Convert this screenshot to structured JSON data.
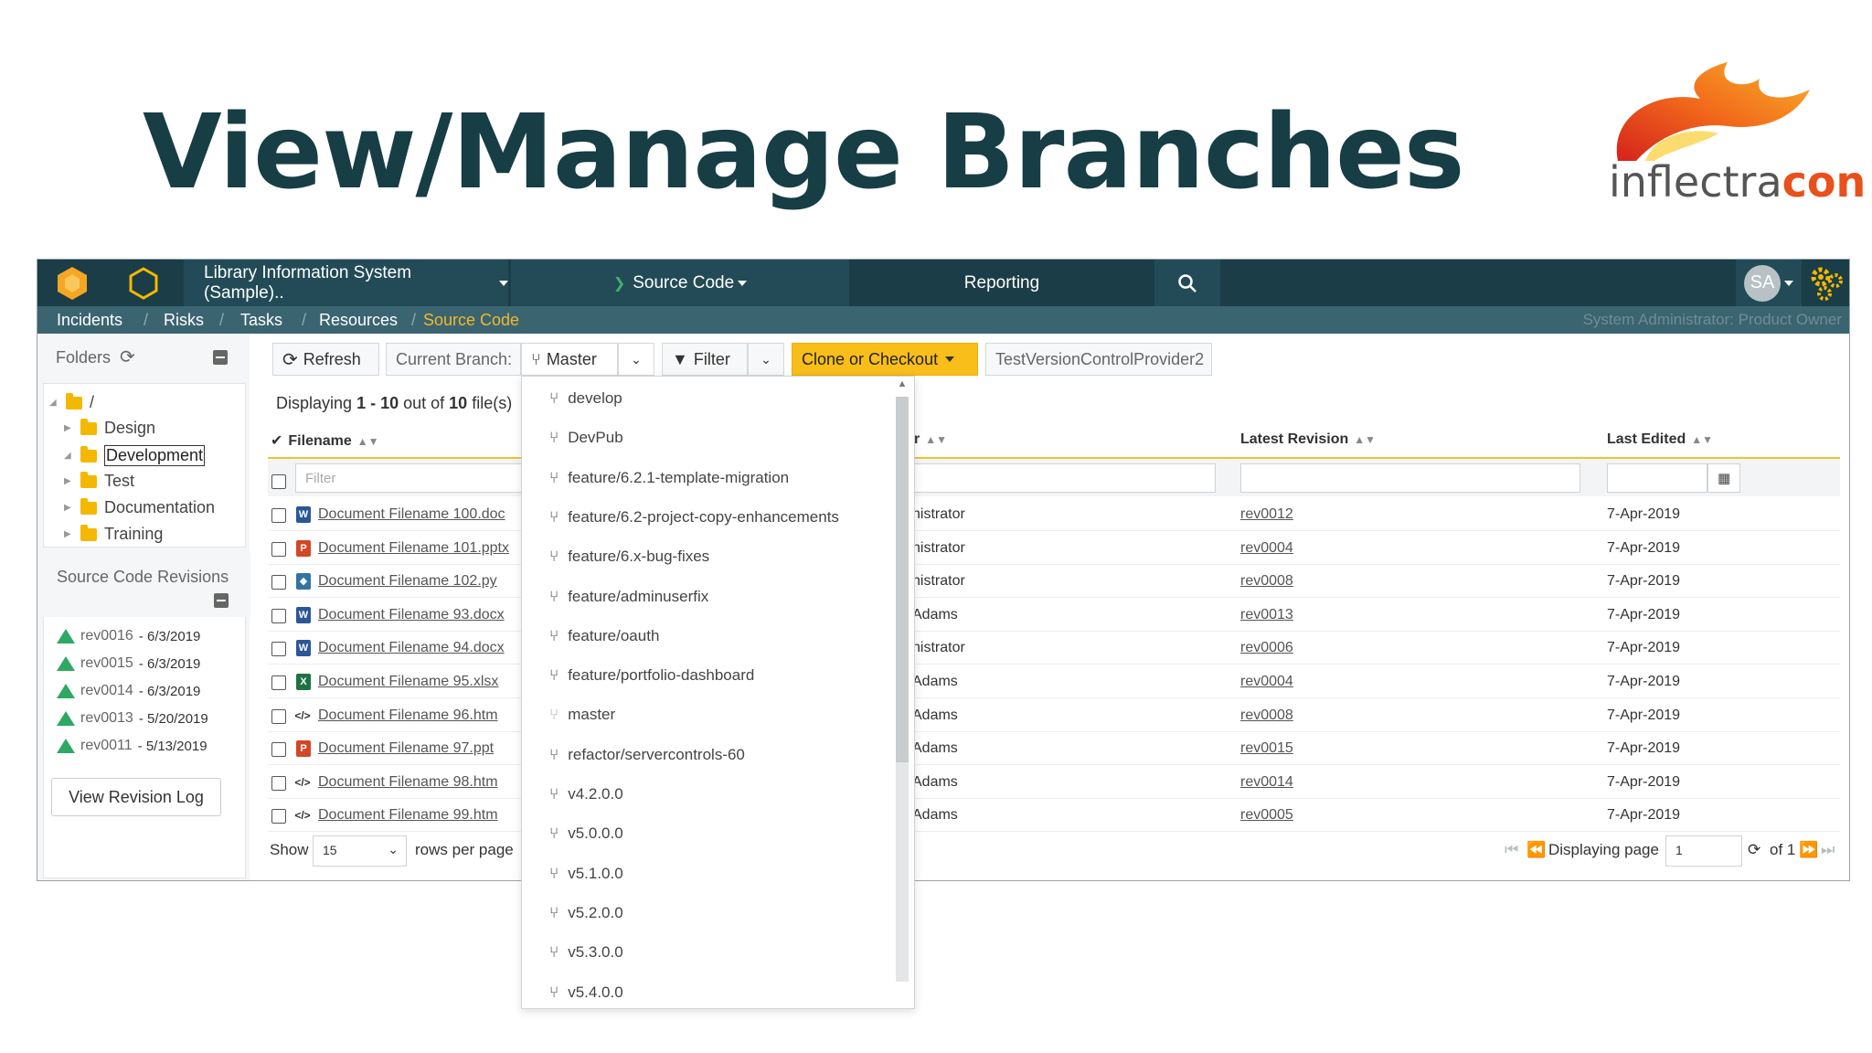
{
  "slide": {
    "title": "View/Manage Branches",
    "brand_part1": "inflectra",
    "brand_part2": "con"
  },
  "app": {
    "project": "Library Information System (Sample)..",
    "nav_source_code": "Source Code",
    "nav_reporting": "Reporting",
    "avatar": "SA",
    "breadcrumb": [
      "Incidents",
      "Risks",
      "Tasks",
      "Resources",
      "Source Code"
    ],
    "user_role": "System Administrator: Product Owner"
  },
  "sidebar": {
    "folders_label": "Folders",
    "tree": [
      {
        "label": "/",
        "expanded": true
      },
      {
        "label": "Design"
      },
      {
        "label": "Development",
        "selected": true
      },
      {
        "label": "Test"
      },
      {
        "label": "Documentation"
      },
      {
        "label": "Training"
      }
    ],
    "revisions_label": "Source Code Revisions",
    "revisions": [
      {
        "rev": "rev0016",
        "date": "6/3/2019"
      },
      {
        "rev": "rev0015",
        "date": "6/3/2019"
      },
      {
        "rev": "rev0014",
        "date": "6/3/2019"
      },
      {
        "rev": "rev0013",
        "date": "5/20/2019"
      },
      {
        "rev": "rev0011",
        "date": "5/13/2019"
      }
    ],
    "view_log": "View Revision Log"
  },
  "toolbar": {
    "refresh": "Refresh",
    "current_branch": "Current Branch:",
    "branch": "Master",
    "filter": "Filter",
    "clone": "Clone or Checkout",
    "provider": "TestVersionControlProvider2"
  },
  "grid": {
    "display_prefix": "Displaying",
    "display_range": "1 - 10",
    "display_middle": "out of",
    "display_total": "10",
    "display_suffix": "file(s)",
    "col_filename": "Filename",
    "col_author_partial": "r",
    "col_latest": "Latest Revision",
    "col_last_edited": "Last Edited",
    "filter_placeholder": "Filter",
    "rows": [
      {
        "name": "Document Filename 100.doc",
        "type": "word",
        "author": "histrator",
        "rev": "rev0012",
        "date": "7-Apr-2019"
      },
      {
        "name": "Document Filename 101.pptx",
        "type": "ppt",
        "author": "histrator",
        "rev": "rev0004",
        "date": "7-Apr-2019"
      },
      {
        "name": "Document Filename 102.py",
        "type": "py",
        "author": "histrator",
        "rev": "rev0008",
        "date": "7-Apr-2019"
      },
      {
        "name": "Document Filename 93.docx",
        "type": "word",
        "author": "Adams",
        "rev": "rev0013",
        "date": "7-Apr-2019"
      },
      {
        "name": "Document Filename 94.docx",
        "type": "word",
        "author": "histrator",
        "rev": "rev0006",
        "date": "7-Apr-2019"
      },
      {
        "name": "Document Filename 95.xlsx",
        "type": "xls",
        "author": "Adams",
        "rev": "rev0004",
        "date": "7-Apr-2019"
      },
      {
        "name": "Document Filename 96.htm",
        "type": "htm",
        "author": "Adams",
        "rev": "rev0008",
        "date": "7-Apr-2019"
      },
      {
        "name": "Document Filename 97.ppt",
        "type": "ppt",
        "author": "Adams",
        "rev": "rev0015",
        "date": "7-Apr-2019"
      },
      {
        "name": "Document Filename 98.htm",
        "type": "htm",
        "author": "Adams",
        "rev": "rev0014",
        "date": "7-Apr-2019"
      },
      {
        "name": "Document Filename 99.htm",
        "type": "htm",
        "author": "Adams",
        "rev": "rev0005",
        "date": "7-Apr-2019"
      }
    ],
    "show_label": "Show",
    "rows_per_page": "15",
    "rows_per_page_label": "rows per page",
    "displaying_page": "Displaying page",
    "page": "1",
    "of_pages": "of 1"
  },
  "branches": [
    "develop",
    "DevPub",
    "feature/6.2.1-template-migration",
    "feature/6.2-project-copy-enhancements",
    "feature/6.x-bug-fixes",
    "feature/adminuserfix",
    "feature/oauth",
    "feature/portfolio-dashboard",
    "master",
    "refactor/servercontrols-60",
    "v4.2.0.0",
    "v5.0.0.0",
    "v5.1.0.0",
    "v5.2.0.0",
    "v5.3.0.0",
    "v5.4.0.0"
  ]
}
